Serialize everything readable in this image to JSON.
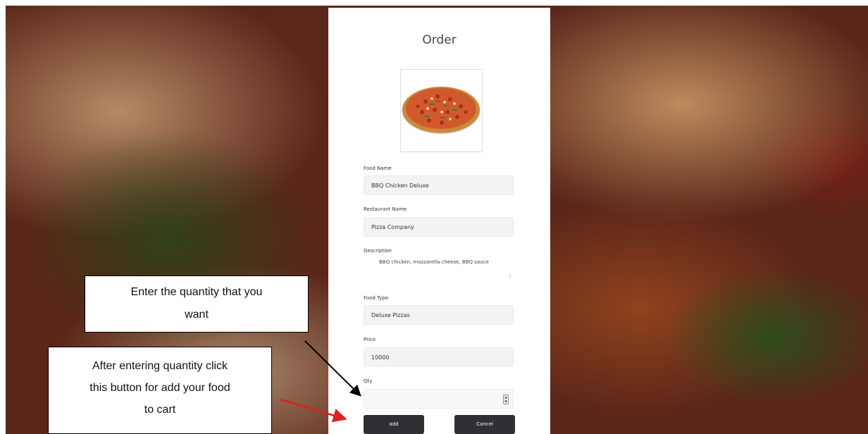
{
  "order": {
    "title": "Order",
    "food_image": "pizza-image",
    "fields": {
      "food_name_label": "Food Name",
      "food_name_value": "BBQ Chicken Deluxe",
      "restaurant_label": "Restaurant Name",
      "restaurant_value": "Pizza Company",
      "description_label": "Description",
      "description_value": "BBQ chicken, mozzarella cheese, BBQ sauce",
      "food_type_label": "Food Type",
      "food_type_value": "Deluxe Pizzas",
      "price_label": "Price",
      "price_value": "10000",
      "qty_label": "Qty",
      "qty_value": ""
    },
    "buttons": {
      "add_label": "add",
      "cancel_label": "Cancel"
    }
  },
  "callouts": {
    "quantity_line1": "Enter the quantity that you",
    "quantity_line2": "want",
    "add_line1": "After entering quantity click",
    "add_line2": "this button for add your food",
    "add_line3": "to cart"
  },
  "colors": {
    "button_bg": "#2f3033",
    "field_bg": "#f3f3f3",
    "arrow_black": "#000000",
    "arrow_red": "#e0201c"
  }
}
